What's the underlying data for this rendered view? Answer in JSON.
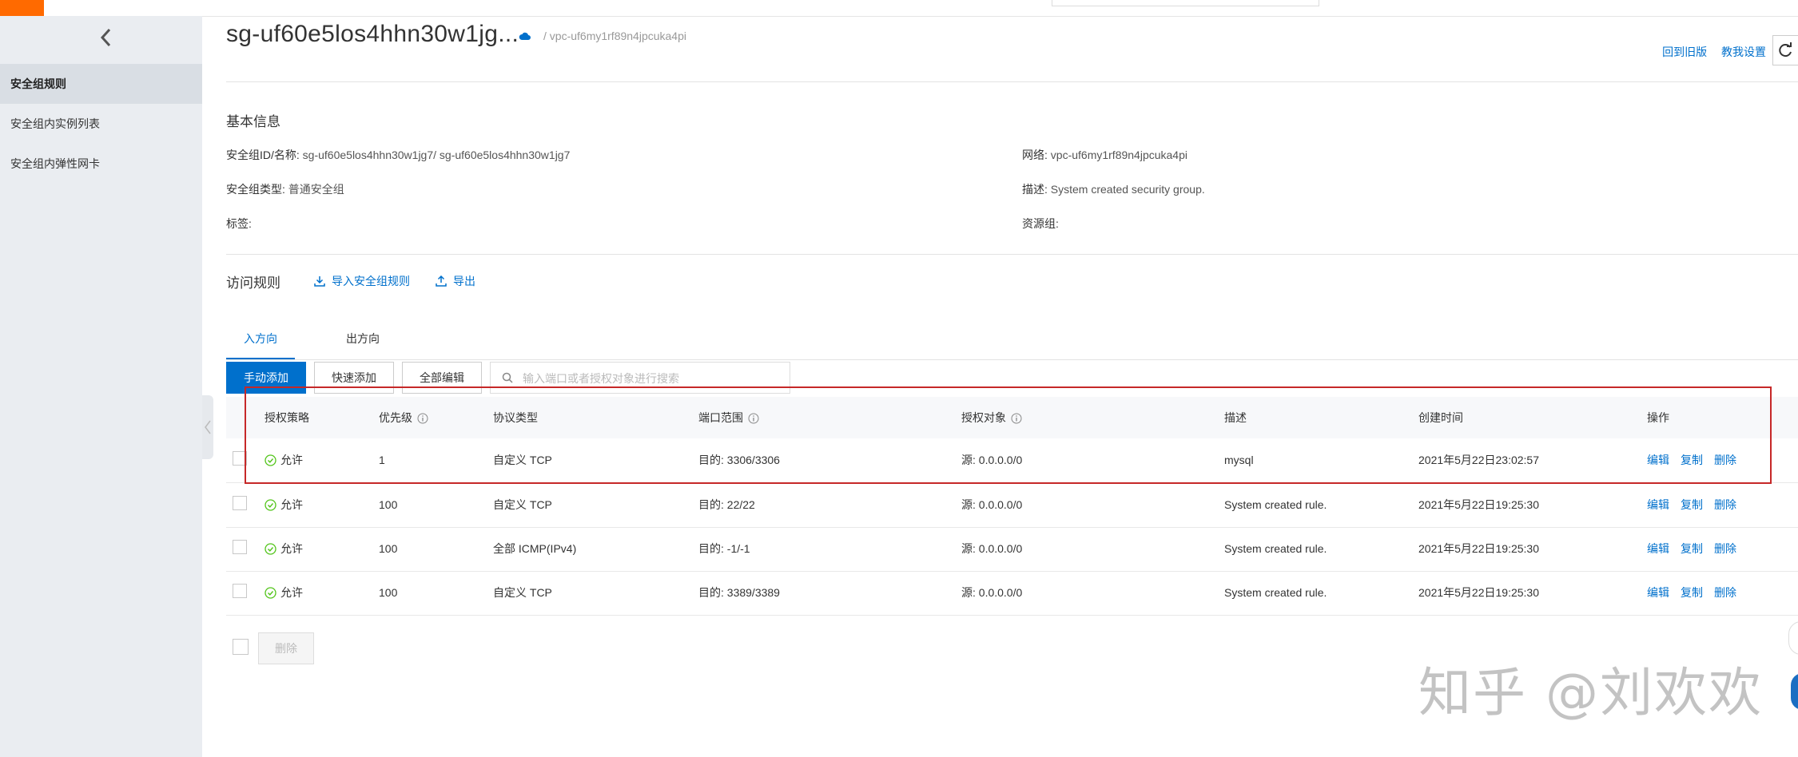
{
  "sidebar": {
    "items": [
      {
        "label": "安全组规则"
      },
      {
        "label": "安全组内实例列表"
      },
      {
        "label": "安全组内弹性网卡"
      }
    ]
  },
  "header": {
    "title": "sg-uf60e5los4hhn30w1jg...",
    "breadcrumb": "/ vpc-uf6my1rf89n4jpcuka4pi",
    "links": [
      "回到旧版",
      "教我设置"
    ]
  },
  "basic_info": {
    "section_title": "基本信息",
    "sg_id_label": "安全组ID/名称:",
    "sg_id_value": "sg-uf60e5los4hhn30w1jg7/ sg-uf60e5los4hhn30w1jg7",
    "network_label": "网络:",
    "network_value": "vpc-uf6my1rf89n4jpcuka4pi",
    "type_label": "安全组类型:",
    "type_value": "普通安全组",
    "desc_label": "描述:",
    "desc_value": "System created security group.",
    "tags_label": "标签:",
    "resource_group_label": "资源组:"
  },
  "rules": {
    "section_title": "访问规则",
    "import_label": "导入安全组规则",
    "export_label": "导出",
    "tabs": [
      "入方向",
      "出方向"
    ],
    "buttons": {
      "manual_add": "手动添加",
      "quick_add": "快速添加",
      "edit_all": "全部编辑",
      "delete": "删除"
    },
    "search_placeholder": "输入端口或者授权对象进行搜索",
    "columns": [
      "授权策略",
      "优先级",
      "协议类型",
      "端口范围",
      "授权对象",
      "描述",
      "创建时间",
      "操作"
    ],
    "rows": [
      {
        "policy": "允许",
        "priority": "1",
        "protocol": "自定义 TCP",
        "port": "目的: 3306/3306",
        "auth": "源: 0.0.0.0/0",
        "desc": "mysql",
        "created": "2021年5月22日23:02:57"
      },
      {
        "policy": "允许",
        "priority": "100",
        "protocol": "自定义 TCP",
        "port": "目的: 22/22",
        "auth": "源: 0.0.0.0/0",
        "desc": "System created rule.",
        "created": "2021年5月22日19:25:30"
      },
      {
        "policy": "允许",
        "priority": "100",
        "protocol": "全部 ICMP(IPv4)",
        "port": "目的: -1/-1",
        "auth": "源: 0.0.0.0/0",
        "desc": "System created rule.",
        "created": "2021年5月22日19:25:30"
      },
      {
        "policy": "允许",
        "priority": "100",
        "protocol": "自定义 TCP",
        "port": "目的: 3389/3389",
        "auth": "源: 0.0.0.0/0",
        "desc": "System created rule.",
        "created": "2021年5月22日19:25:30"
      }
    ],
    "ops": [
      "编辑",
      "复制",
      "删除"
    ]
  },
  "watermark": "知乎 @刘欢欢",
  "colors": {
    "accent": "#0070cc",
    "brand": "#ff6a00",
    "highlight": "#c62828",
    "ok": "#52c41a"
  }
}
